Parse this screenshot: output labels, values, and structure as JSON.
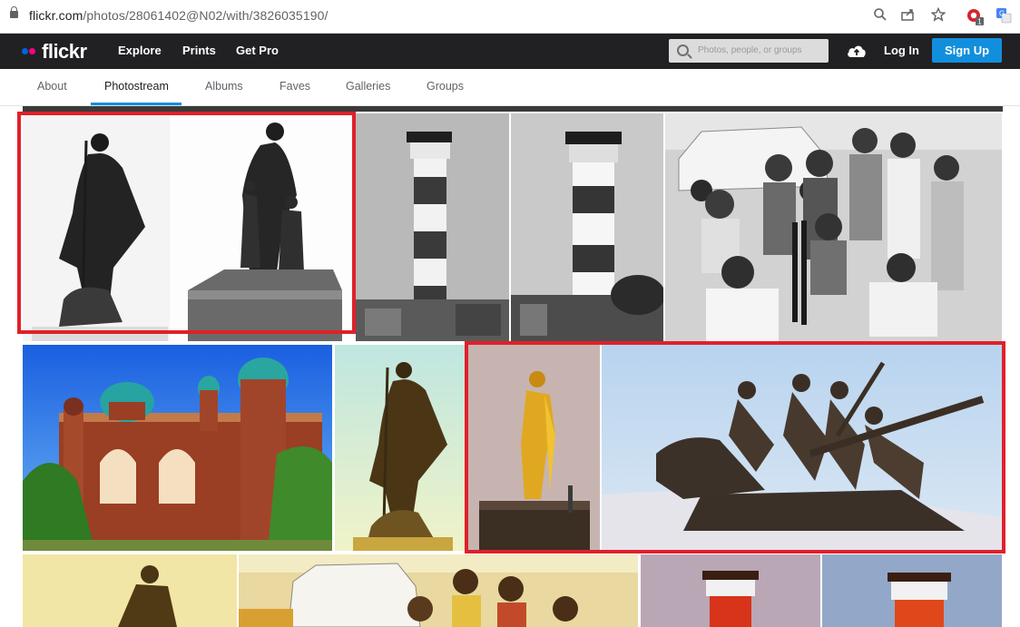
{
  "browser": {
    "url_host": "flickr.com",
    "url_path": "/photos/28061402@N02/with/3826035190/",
    "icons": [
      "lock-icon",
      "zoom-icon",
      "share-icon",
      "star-icon",
      "extension-icon",
      "translate-icon"
    ],
    "extension_badge": "1"
  },
  "header": {
    "logo": "flickr",
    "nav": [
      "Explore",
      "Prints",
      "Get Pro"
    ],
    "search_placeholder": "Photos, people, or groups",
    "login": "Log In",
    "signup": "Sign Up"
  },
  "subnav": {
    "tabs": [
      "About",
      "Photostream",
      "Albums",
      "Faves",
      "Galleries",
      "Groups"
    ],
    "active": "Photostream"
  },
  "colors": {
    "header_bg": "#212124",
    "accent_blue": "#128fdc",
    "highlight_red": "#e0202a",
    "logo_blue": "#0063dc",
    "logo_pink": "#ff0084"
  },
  "gallery": {
    "photos": [
      "bw-gandhi-statue",
      "bw-statue-with-children",
      "bw-lighthouse-1",
      "bw-lighthouse-2",
      "bw-children-group",
      "color-madras-high-court",
      "color-gandhi-statue",
      "color-golden-statue",
      "color-labour-statue",
      "color-statue-warm",
      "color-children-car",
      "color-lighthouse-1",
      "color-lighthouse-2"
    ]
  }
}
